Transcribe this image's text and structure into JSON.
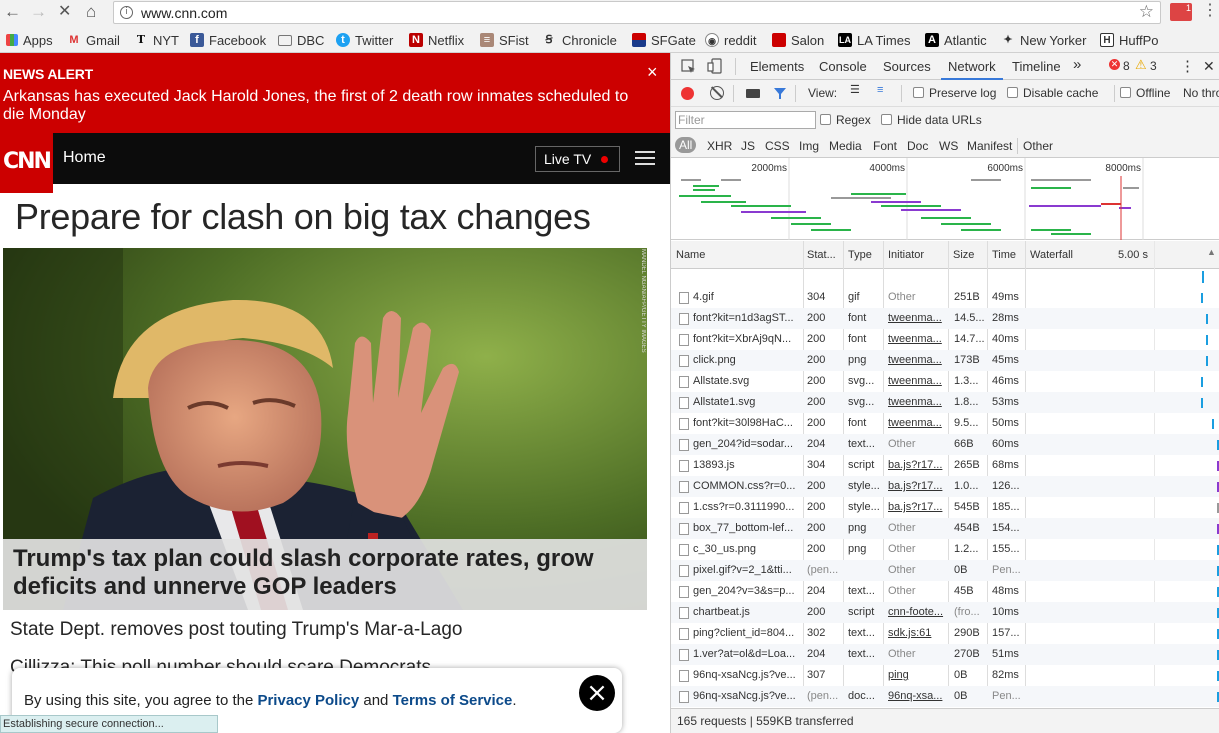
{
  "browser": {
    "url": "www.cnn.com",
    "back_icon": "←",
    "forward_icon": "→",
    "stop_icon": "✕",
    "home_icon": "⌂",
    "info_icon": "i",
    "star_icon": "☆",
    "gmail_badge": "1",
    "menu_icon": "⋮"
  },
  "bookmarks": [
    {
      "label": "Apps"
    },
    {
      "label": "Gmail"
    },
    {
      "label": "NYT"
    },
    {
      "label": "Facebook"
    },
    {
      "label": "DBC"
    },
    {
      "label": "Twitter"
    },
    {
      "label": "Netflix"
    },
    {
      "label": "SFist"
    },
    {
      "label": "Chronicle"
    },
    {
      "label": "SFGate"
    },
    {
      "label": "reddit"
    },
    {
      "label": "Salon"
    },
    {
      "label": "LA Times"
    },
    {
      "label": "Atlantic"
    },
    {
      "label": "New Yorker"
    },
    {
      "label": "HuffPo"
    }
  ],
  "page": {
    "alert_label": "NEWS ALERT",
    "alert_text": "Arkansas has executed Jack Harold Jones, the first of 2 death row inmates scheduled to die Monday",
    "alert_close": "×",
    "logo": "CNN",
    "home": "Home",
    "live_tv": "Live TV",
    "headline": "Prepare for clash on big tax changes",
    "hero_caption": "Trump's tax plan could slash corporate rates, grow deficits and unnerve GOP leaders",
    "photo_credit": "MANDEL NGAN/AFP/GETTY IMAGES",
    "story1": "State Dept. removes post touting Trump's Mar-a-Lago",
    "story2": "Cillizza: This poll number should scare Democrats",
    "cookie_prefix": "By using this site, you agree to the ",
    "cookie_privacy": "Privacy Policy",
    "cookie_and": " and ",
    "cookie_terms": "Terms of Service",
    "cookie_suffix": ".",
    "cookie_close": "×",
    "status": "Establishing secure connection..."
  },
  "devtools": {
    "tabs": [
      "Elements",
      "Console",
      "Sources",
      "Network",
      "Timeline"
    ],
    "more_icon": "»",
    "errors": "8",
    "warnings": "3",
    "close_icon": "✕",
    "view_label": "View:",
    "preserve_log": "Preserve log",
    "disable_cache": "Disable cache",
    "offline": "Offline",
    "throttle": "No thro",
    "filter_placeholder": "Filter",
    "regex": "Regex",
    "hide_data_urls": "Hide data URLs",
    "types": [
      "All",
      "XHR",
      "JS",
      "CSS",
      "Img",
      "Media",
      "Font",
      "Doc",
      "WS",
      "Manifest",
      "Other"
    ],
    "overview_ticks": [
      "2000ms",
      "4000ms",
      "6000ms",
      "8000ms"
    ],
    "columns": [
      "Name",
      "Stat...",
      "Type",
      "Initiator",
      "Size",
      "Time",
      "Waterfall"
    ],
    "waterfall_scale": "5.00 s",
    "status": "165 requests | 559KB transferred",
    "rows": [
      {
        "name": "4.gif",
        "status": "304",
        "type": "gif",
        "initiator": "Other",
        "size": "251B",
        "time": "49ms",
        "link": false,
        "wf": 0.32,
        "color": "#1a9ee0"
      },
      {
        "name": "font?kit=n1d3agST...",
        "status": "200",
        "type": "font",
        "initiator": "tweenma...",
        "size": "14.5...",
        "time": "28ms",
        "link": true,
        "wf": 0.33,
        "color": "#1a9ee0"
      },
      {
        "name": "font?kit=XbrAj9qN...",
        "status": "200",
        "type": "font",
        "initiator": "tweenma...",
        "size": "14.7...",
        "time": "40ms",
        "link": true,
        "wf": 0.33,
        "color": "#1a9ee0"
      },
      {
        "name": "click.png",
        "status": "200",
        "type": "png",
        "initiator": "tweenma...",
        "size": "173B",
        "time": "45ms",
        "link": true,
        "wf": 0.33,
        "color": "#1a9ee0"
      },
      {
        "name": "Allstate.svg",
        "status": "200",
        "type": "svg...",
        "initiator": "tweenma...",
        "size": "1.3...",
        "time": "46ms",
        "link": true,
        "wf": 0.32,
        "color": "#1a9ee0"
      },
      {
        "name": "Allstate1.svg",
        "status": "200",
        "type": "svg...",
        "initiator": "tweenma...",
        "size": "1.8...",
        "time": "53ms",
        "link": true,
        "wf": 0.32,
        "color": "#1a9ee0"
      },
      {
        "name": "font?kit=30l98HaC...",
        "status": "200",
        "type": "font",
        "initiator": "tweenma...",
        "size": "9.5...",
        "time": "50ms",
        "link": true,
        "wf": 0.34,
        "color": "#1a9ee0"
      },
      {
        "name": "gen_204?id=sodar...",
        "status": "204",
        "type": "text...",
        "initiator": "Other",
        "size": "66B",
        "time": "60ms",
        "link": false,
        "wf": 0.35,
        "color": "#1a9ee0"
      },
      {
        "name": "13893.js",
        "status": "304",
        "type": "script",
        "initiator": "ba.js?r17...",
        "size": "265B",
        "time": "68ms",
        "link": true,
        "wf": 0.35,
        "color": "#8a3ad0"
      },
      {
        "name": "COMMON.css?r=0...",
        "status": "200",
        "type": "style...",
        "initiator": "ba.js?r17...",
        "size": "1.0...",
        "time": "126...",
        "link": true,
        "wf": 0.35,
        "color": "#8a3ad0"
      },
      {
        "name": "1.css?r=0.3111990...",
        "status": "200",
        "type": "style...",
        "initiator": "ba.js?r17...",
        "size": "545B",
        "time": "185...",
        "link": true,
        "wf": 0.35,
        "color": "#999"
      },
      {
        "name": "box_77_bottom-lef...",
        "status": "200",
        "type": "png",
        "initiator": "Other",
        "size": "454B",
        "time": "154...",
        "link": false,
        "wf": 0.35,
        "color": "#8a3ad0"
      },
      {
        "name": "c_30_us.png",
        "status": "200",
        "type": "png",
        "initiator": "Other",
        "size": "1.2...",
        "time": "155...",
        "link": false,
        "wf": 0.35,
        "color": "#1a9ee0"
      },
      {
        "name": "pixel.gif?v=2_1&tti...",
        "status": "(pen...",
        "type": "",
        "initiator": "Other",
        "size": "0B",
        "time": "Pen...",
        "link": false,
        "wf": 0.35,
        "color": "#1a9ee0"
      },
      {
        "name": "gen_204?v=3&s=p...",
        "status": "204",
        "type": "text...",
        "initiator": "Other",
        "size": "45B",
        "time": "48ms",
        "link": false,
        "wf": 0.35,
        "color": "#1a9ee0"
      },
      {
        "name": "chartbeat.js",
        "status": "200",
        "type": "script",
        "initiator": "cnn-foote...",
        "size": "(fro...",
        "time": "10ms",
        "link": true,
        "wf": 0.35,
        "color": "#1a9ee0"
      },
      {
        "name": "ping?client_id=804...",
        "status": "302",
        "type": "text...",
        "initiator": "sdk.js:61",
        "size": "290B",
        "time": "157...",
        "link": true,
        "wf": 0.35,
        "color": "#1a9ee0"
      },
      {
        "name": "1.ver?at=ol&d=Loa...",
        "status": "204",
        "type": "text...",
        "initiator": "Other",
        "size": "270B",
        "time": "51ms",
        "link": false,
        "wf": 0.35,
        "color": "#1a9ee0"
      },
      {
        "name": "96nq-xsaNcg.js?ve...",
        "status": "307",
        "type": "",
        "initiator": "ping",
        "size": "0B",
        "time": "82ms",
        "link": true,
        "wf": 0.35,
        "color": "#1a9ee0"
      },
      {
        "name": "96nq-xsaNcg.js?ve...",
        "status": "(pen...",
        "type": "doc...",
        "initiator": "96nq-xsa...",
        "size": "0B",
        "time": "Pen...",
        "link": true,
        "wf": 0.35,
        "color": "#1a9ee0"
      }
    ]
  }
}
